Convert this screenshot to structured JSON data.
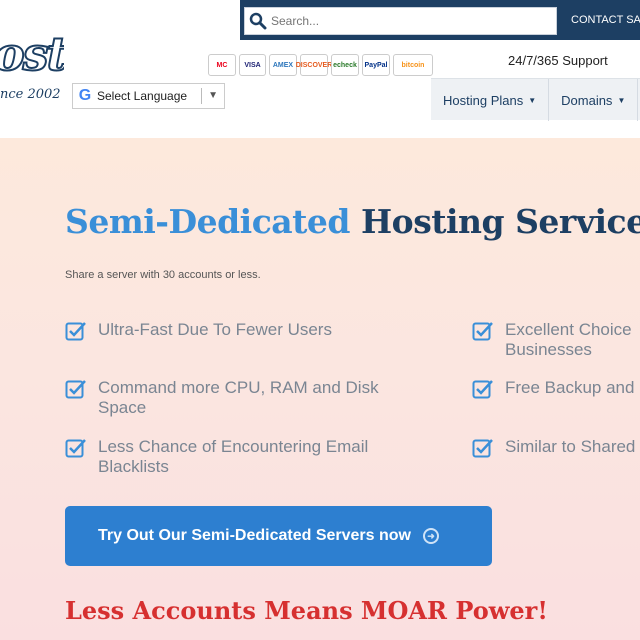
{
  "header": {
    "search": {
      "placeholder": "Search..."
    },
    "contact_label": "CONTACT SAL",
    "logo": {
      "word": "ost",
      "since": "nce 2002"
    },
    "payments": [
      {
        "name": "mastercard-icon",
        "label": "MC",
        "color": "#eb001b"
      },
      {
        "name": "visa-icon",
        "label": "VISA",
        "color": "#1a1f71"
      },
      {
        "name": "amex-icon",
        "label": "AMEX",
        "color": "#2e77bc"
      },
      {
        "name": "discover-icon",
        "label": "DISCOVER",
        "color": "#e55c20"
      },
      {
        "name": "echeck-icon",
        "label": "echeck",
        "color": "#2a7a2a"
      },
      {
        "name": "paypal-icon",
        "label": "PayPal",
        "color": "#003087"
      },
      {
        "name": "bitcoin-icon",
        "label": "bitcoin",
        "color": "#f7931a"
      }
    ],
    "language_label": "Select Language",
    "support": "24/7/365 Support",
    "nav": [
      {
        "label": "Hosting Plans"
      },
      {
        "label": "Domains"
      }
    ]
  },
  "hero": {
    "title_part1": "Semi-Dedicated",
    "title_part2": "Hosting Service",
    "subtitle": "Share a server with 30 accounts or less.",
    "features_left": [
      "Ultra-Fast Due To Fewer Users",
      "Command more CPU, RAM and Disk Space",
      "Less Chance of Encountering Email Blacklists"
    ],
    "features_right": [
      "Excellent Choice Businesses",
      "Free Backup and",
      "Similar to Shared"
    ],
    "cta_label": "Try Out Our Semi-Dedicated Servers now",
    "tagline": "Less Accounts Means MOAR Power!"
  },
  "colors": {
    "brand_navy": "#1d3f63",
    "accent_blue": "#2d7fd0",
    "tagline_red": "#d63030"
  }
}
